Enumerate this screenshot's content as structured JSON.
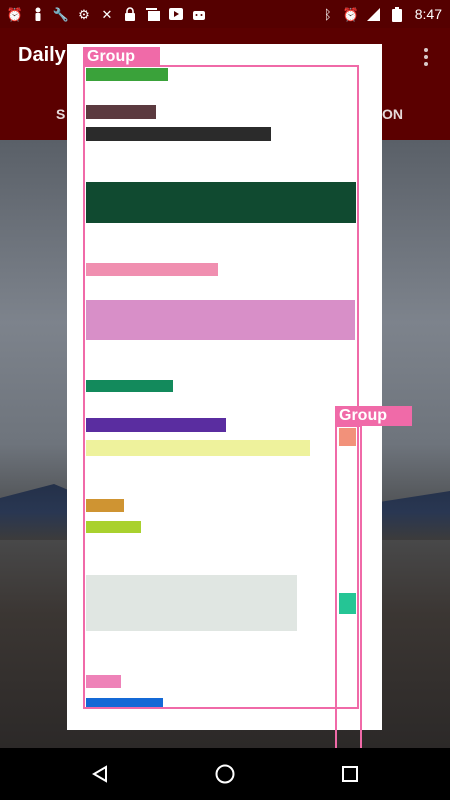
{
  "status_bar": {
    "time": "8:47",
    "left_icons": [
      "alarm-icon",
      "person-icon",
      "wrench-icon",
      "settings-circle-icon",
      "satellite-off-icon",
      "lock-icon",
      "photo-stack-icon",
      "youtube-icon",
      "android-icon"
    ],
    "right_icons": [
      "bluetooth-icon",
      "alarm-icon",
      "signal-icon",
      "battery-icon"
    ]
  },
  "app_bar": {
    "title": "Daily",
    "tab_left": "S",
    "tab_right": "ON"
  },
  "dialog": {
    "group_label_main": "Group",
    "group_label_side": "Group"
  },
  "colors": {
    "green": "#3aa23a",
    "maroon": "#5b3a3f",
    "dark": "#2b2b2b",
    "forest": "#104a30",
    "pink": "#f08fb0",
    "orchid": "#d88fc8",
    "teal": "#138a5c",
    "purple": "#5a2da0",
    "yellow": "#eef29c",
    "ochre": "#cf9432",
    "lime": "#a9d12e",
    "mint": "#e0e6e2",
    "magenta": "#ee82b8",
    "blue": "#1469d6",
    "salmon": "#f2917a",
    "turquoise": "#25c595",
    "brown": "#6a4040",
    "group": "#f06aa8"
  }
}
